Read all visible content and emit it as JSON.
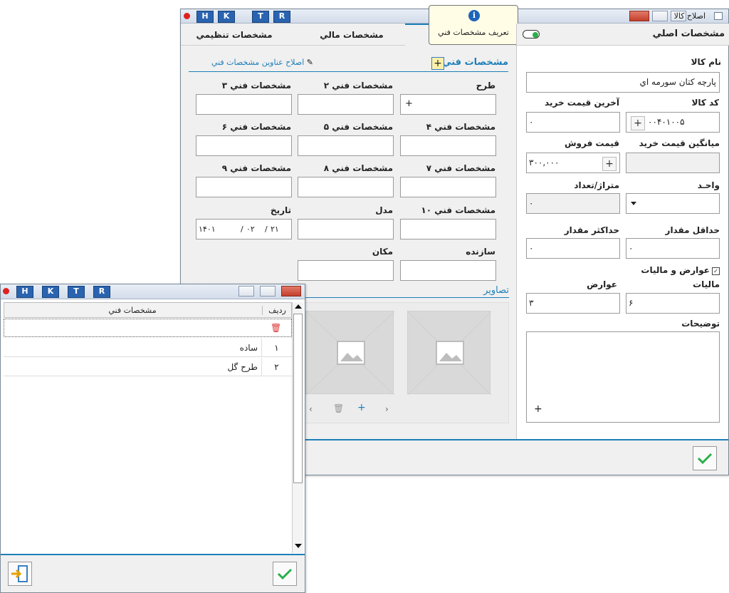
{
  "main_window": {
    "title": "اصلاح كالا",
    "hk_buttons": [
      "H",
      "K",
      "T",
      "R"
    ],
    "tabs": {
      "basic": "مشخصات اصلي",
      "financial": "مشخصات مالي",
      "settings": "مشخصات تنظيمي"
    },
    "tooltip": "تعريف مشخصات فني",
    "left": {
      "item_name_label": "نام كالا",
      "item_name_value": "پارچه كتان سورمه اي",
      "item_code_label": "كد كالا",
      "item_code_value": "۰۰۴۰۱۰۰۵",
      "last_price_label": "آخرين قيمت خريد",
      "last_price_value": "۰",
      "avg_price_label": "ميانگين قيمت خريد",
      "avg_price_value": "",
      "sale_price_label": "قيمت فروش",
      "sale_price_value": "۳۰۰,۰۰۰",
      "unit_label": "واحـد",
      "unit_value": "",
      "meterage_label": "متراژ/تعداد",
      "meterage_value": "۰",
      "min_qty_label": "حداقل مقدار",
      "min_qty_value": "۰",
      "max_qty_label": "حداكثر مقدار",
      "max_qty_value": "۰",
      "duties_tax_label": "عوارض و ماليات",
      "tax_label": "ماليات",
      "tax_value": "۶",
      "duties_label": "عوارض",
      "duties_value": "۳",
      "desc_label": "توضيحات",
      "desc_plus": "+"
    },
    "tech": {
      "header": "مشخصات فني",
      "edit_titles_link": "اصلاح عناوين مشخصات فني",
      "fields": {
        "design": "طرح",
        "spec2": "مشخصات فني ۲",
        "spec3": "مشخصات فني ۳",
        "spec4": "مشخصات فني ۴",
        "spec5": "مشخصات فني ۵",
        "spec6": "مشخصات فني ۶",
        "spec7": "مشخصات فني ۷",
        "spec8": "مشخصات فني ۸",
        "spec9": "مشخصات فني ۹",
        "spec10": "مشخصات فني ۱۰",
        "model": "مدل",
        "date": "تاريخ",
        "maker": "سازنده",
        "place": "مكان"
      },
      "date_value": {
        "year": "۱۴۰۱",
        "month": "۰۲",
        "day": "۲۱"
      },
      "images_label": "تصاوير"
    }
  },
  "popup_window": {
    "hk_buttons": [
      "H",
      "K",
      "T",
      "R"
    ],
    "columns": {
      "row": "رديف",
      "spec": "مشخصات فني"
    },
    "rows": [
      {
        "row": "۱",
        "spec": "ساده"
      },
      {
        "row": "۲",
        "spec": "طرح گل"
      }
    ]
  },
  "colors": {
    "accent": "#1e7fb8",
    "check": "#2ab04a",
    "titlebar": "#d9e2ee",
    "hk": "#2a64b0"
  }
}
